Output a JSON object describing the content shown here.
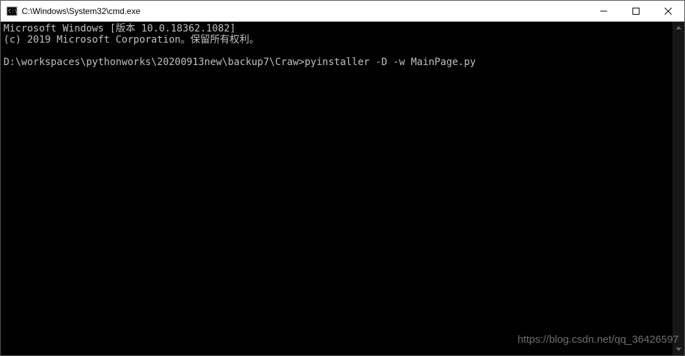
{
  "titlebar": {
    "title": "C:\\Windows\\System32\\cmd.exe"
  },
  "console": {
    "line1": "Microsoft Windows [版本 10.0.18362.1082]",
    "line2": "(c) 2019 Microsoft Corporation。保留所有权利。",
    "blank": "",
    "prompt": "D:\\workspaces\\pythonworks\\20200913new\\backup7\\Craw>",
    "command": "pyinstaller -D -w MainPage.py"
  },
  "watermark": "https://blog.csdn.net/qq_36426597"
}
